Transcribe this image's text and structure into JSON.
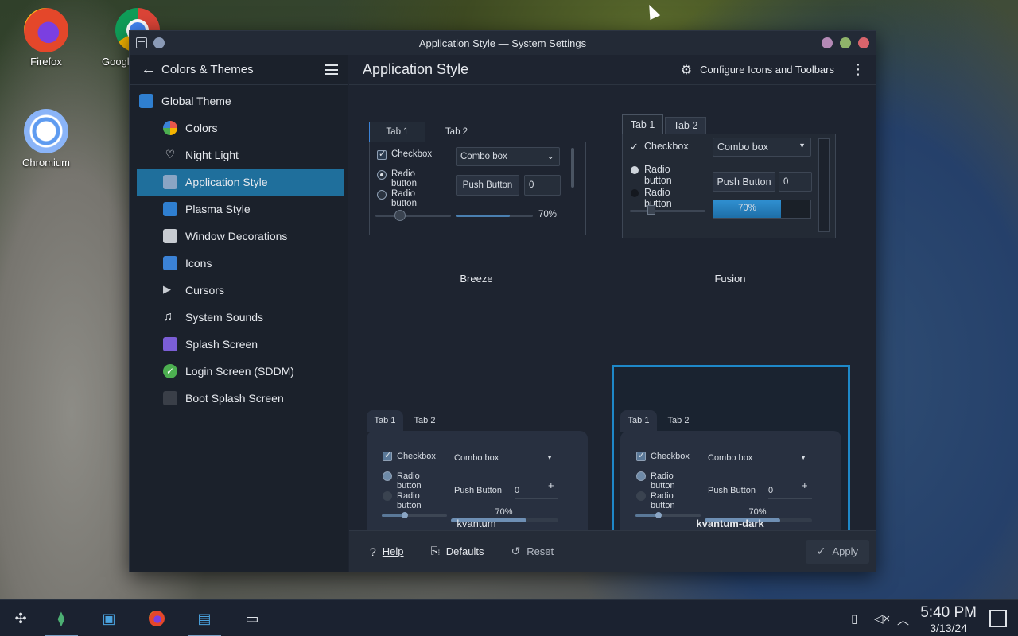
{
  "desktop": {
    "icons": [
      {
        "label": "Firefox"
      },
      {
        "label": "Googl"
      },
      {
        "label": "Chromium"
      }
    ]
  },
  "window": {
    "title": "Application Style — System Settings"
  },
  "sidebar": {
    "header": "Colors & Themes",
    "items": [
      {
        "label": "Global Theme",
        "icon": "global-theme-icon",
        "color": "#2f7fd0"
      },
      {
        "label": "Colors",
        "icon": "colors-icon",
        "color": "#e8574a"
      },
      {
        "label": "Night Light",
        "icon": "lightbulb-icon",
        "color": "#dfe3e8"
      },
      {
        "label": "Application Style",
        "icon": "application-style-icon",
        "color": "#8aa5c4"
      },
      {
        "label": "Plasma Style",
        "icon": "plasma-style-icon",
        "color": "#2f7fd0"
      },
      {
        "label": "Window Decorations",
        "icon": "window-decorations-icon",
        "color": "#c8ccd2"
      },
      {
        "label": "Icons",
        "icon": "icons-icon",
        "color": "#3b82d6"
      },
      {
        "label": "Cursors",
        "icon": "cursor-icon",
        "color": "#c8ccd2"
      },
      {
        "label": "System Sounds",
        "icon": "music-note-icon",
        "color": "#dfe3e8"
      },
      {
        "label": "Splash Screen",
        "icon": "splash-screen-icon",
        "color": "#7b5ed6"
      },
      {
        "label": "Login Screen (SDDM)",
        "icon": "login-screen-icon",
        "color": "#4caf50"
      },
      {
        "label": "Boot Splash Screen",
        "icon": "boot-splash-icon",
        "color": "#3a3f48"
      }
    ],
    "active_index": 3
  },
  "content": {
    "title": "Application Style",
    "configure_button": "Configure Icons and Toolbars"
  },
  "styles": [
    {
      "name": "Breeze",
      "tab1": "Tab 1",
      "tab2": "Tab 2",
      "checkbox": "Checkbox",
      "radio1": "Radio button",
      "radio2": "Radio button",
      "combo": "Combo box",
      "push": "Push Button",
      "spin": "0",
      "progress": "70%",
      "progress_value": 0.7,
      "selected": false
    },
    {
      "name": "Fusion",
      "tab1": "Tab 1",
      "tab2": "Tab 2",
      "checkbox": "Checkbox",
      "radio1": "Radio button",
      "radio2": "Radio button",
      "combo": "Combo box",
      "push": "Push Button",
      "spin": "0",
      "progress": "70%",
      "progress_value": 0.7,
      "selected": false
    },
    {
      "name": "kvantum",
      "tab1": "Tab 1",
      "tab2": "Tab 2",
      "checkbox": "Checkbox",
      "radio1": "Radio button",
      "radio2": "Radio button",
      "combo": "Combo box",
      "push": "Push Button",
      "spin": "0",
      "progress": "70%",
      "progress_value": 0.7,
      "selected": false
    },
    {
      "name": "kvantum-dark",
      "tab1": "Tab 1",
      "tab2": "Tab 2",
      "checkbox": "Checkbox",
      "radio1": "Radio button",
      "radio2": "Radio button",
      "combo": "Combo box",
      "push": "Push Button",
      "spin": "0",
      "progress": "70%",
      "progress_value": 0.7,
      "selected": true
    }
  ],
  "footer": {
    "help": "Help",
    "defaults": "Defaults",
    "reset": "Reset",
    "apply": "Apply"
  },
  "taskbar": {
    "time": "5:40 PM",
    "date": "3/13/24"
  },
  "colors": {
    "accent": "#1f6f9c",
    "selection_border": "#1e88c8",
    "window_bg": "#1e2430"
  }
}
